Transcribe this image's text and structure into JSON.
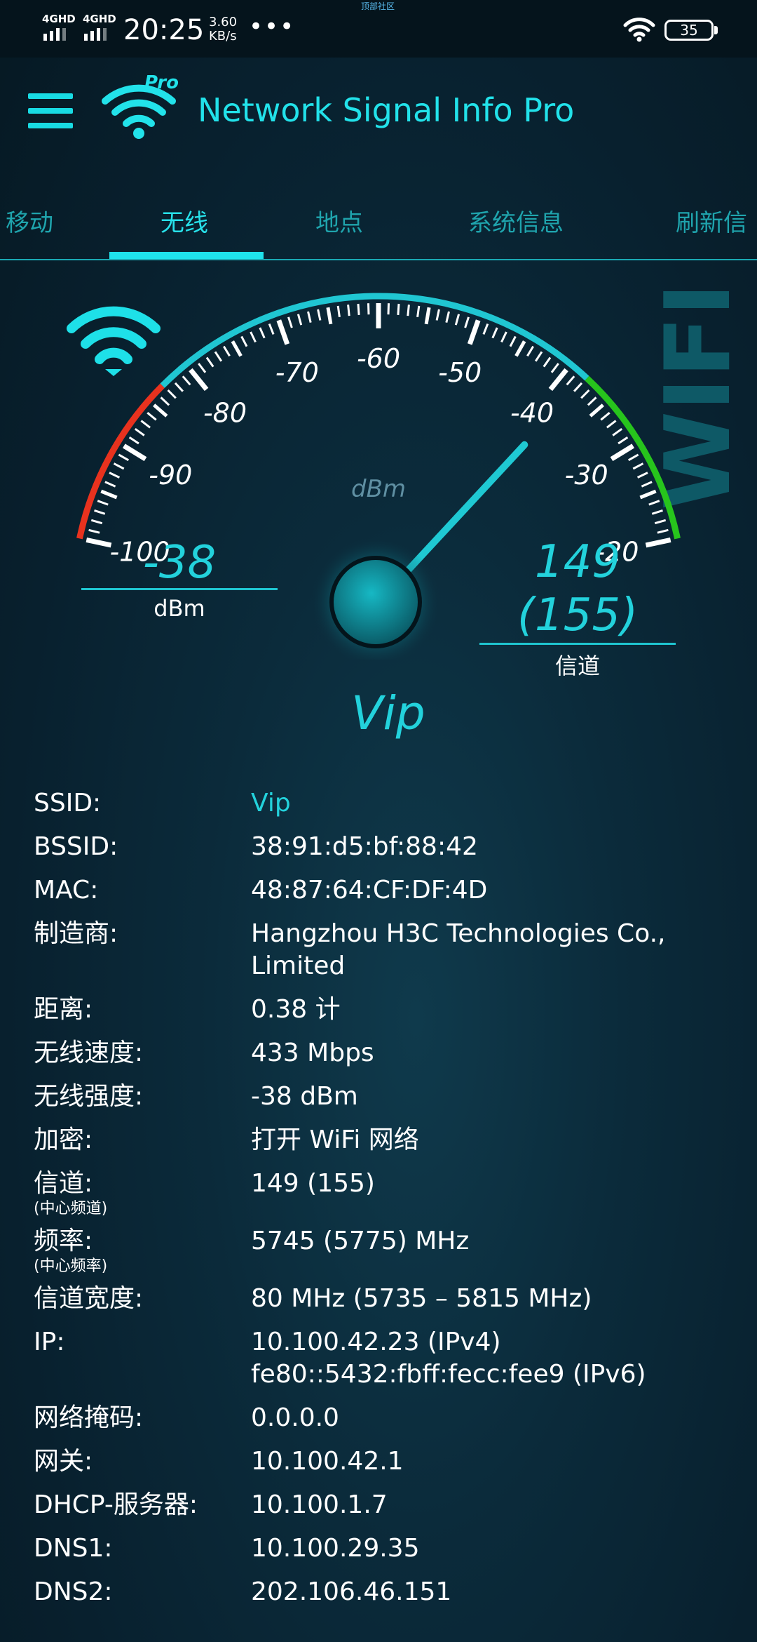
{
  "status_bar": {
    "net1": "4GHD",
    "net2": "4GHD",
    "time": "20:25",
    "speed_value": "3.60",
    "speed_unit": "KB/s",
    "more": "•••",
    "tiny_text": "顶部社区",
    "battery": "35"
  },
  "app_bar": {
    "title": "Network Signal Info Pro",
    "logo_badge": "Pro"
  },
  "tabs": [
    {
      "label": "移动",
      "active": false
    },
    {
      "label": "无线",
      "active": true
    },
    {
      "label": "地点",
      "active": false
    },
    {
      "label": "系统信息",
      "active": false
    },
    {
      "label": "刷新信",
      "active": false
    }
  ],
  "gauge": {
    "unit_label": "dBm",
    "min": -100,
    "max": -20,
    "reading": -38,
    "tick_labels": [
      "-100",
      "-90",
      "-80",
      "-70",
      "-60",
      "-50",
      "-40",
      "-30",
      "-20"
    ],
    "watermark": "WIFI",
    "colors": {
      "weak": "#e8321e",
      "mid": "#20c6d2",
      "strong": "#27c41c",
      "needle": "#1fc9d3"
    }
  },
  "signal": {
    "value": "-38",
    "unit": "dBm"
  },
  "channel": {
    "value": "149",
    "center": "(155)",
    "label": "信道"
  },
  "ssid_display": "Vip",
  "info_rows": [
    {
      "key": "SSID:",
      "value": "Vip",
      "highlight": true
    },
    {
      "key": "BSSID:",
      "value": "38:91:d5:bf:88:42"
    },
    {
      "key": "MAC:",
      "value": "48:87:64:CF:DF:4D"
    },
    {
      "key": "制造商:",
      "value": "Hangzhou H3C Technologies Co., Limited"
    },
    {
      "key": "距离:",
      "value": "0.38 计"
    },
    {
      "key": "无线速度:",
      "value": "433 Mbps"
    },
    {
      "key": "无线强度:",
      "value": "-38 dBm"
    },
    {
      "key": "加密:",
      "value": "打开 WiFi 网络"
    },
    {
      "key": "信道:",
      "sub": "(中心频道)",
      "value": "149 (155)"
    },
    {
      "key": "频率:",
      "sub": "(中心频率)",
      "value": "5745 (5775) MHz"
    },
    {
      "key": "信道宽度:",
      "value": "80 MHz (5735 – 5815 MHz)"
    },
    {
      "key": "IP:",
      "value": "10.100.42.23 (IPv4)",
      "value2": "fe80::5432:fbff:fecc:fee9 (IPv6)"
    },
    {
      "key": "网络掩码:",
      "value": "0.0.0.0"
    },
    {
      "key": "网关:",
      "value": "10.100.42.1"
    },
    {
      "key": "DHCP-服务器:",
      "value": "10.100.1.7"
    },
    {
      "key": "DNS1:",
      "value": "10.100.29.35"
    },
    {
      "key": "DNS2:",
      "value": "202.106.46.151"
    }
  ]
}
